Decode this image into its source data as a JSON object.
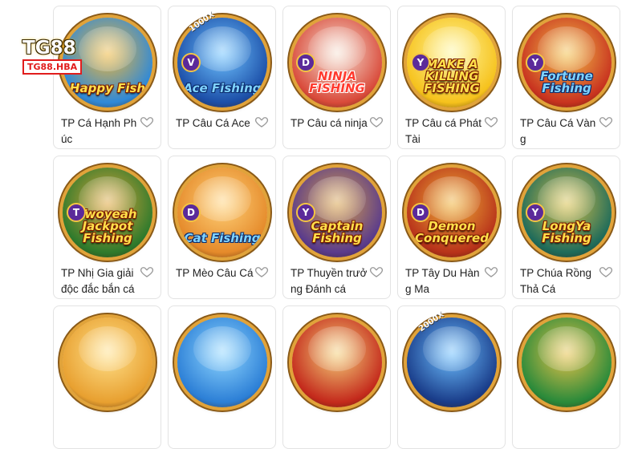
{
  "logo": {
    "brand": "TG88",
    "domain": "TG88.HBA"
  },
  "games": [
    {
      "name": "TP Cá Hạnh Phúc",
      "art_title": "Happy Fish",
      "badge": "",
      "ribbon": "",
      "colors": [
        "#2f89d8",
        "#f0b73a"
      ]
    },
    {
      "name": "TP Câu Cá Ace",
      "art_title": "Ace Fishing",
      "badge": "V",
      "ribbon": "1000X",
      "colors": [
        "#1c4fa8",
        "#6fc3ff"
      ]
    },
    {
      "name": "TP Câu cá ninja",
      "art_title": "NINJA FISHING",
      "badge": "D",
      "ribbon": "",
      "colors": [
        "#d94a3a",
        "#f6e4d6"
      ]
    },
    {
      "name": "TP Câu cá Phát Tài",
      "art_title": "MAKE A KILLING FISHING",
      "badge": "Y",
      "ribbon": "",
      "colors": [
        "#f6c21c",
        "#fff7a0"
      ]
    },
    {
      "name": "TP Câu Cá Vàng",
      "art_title": "Fortune Fishing",
      "badge": "Y",
      "ribbon": "",
      "colors": [
        "#c8321f",
        "#f3c14a"
      ]
    },
    {
      "name": "TP Nhị Gia giải độc đắc bắn cá",
      "art_title": "Twoyeah Jackpot Fishing",
      "badge": "T",
      "ribbon": "",
      "colors": [
        "#2e7a2c",
        "#e0a53a"
      ]
    },
    {
      "name": "TP Mèo Câu Cá",
      "art_title": "Cat Fishing",
      "badge": "D",
      "ribbon": "",
      "colors": [
        "#e58a2a",
        "#ffd27a"
      ]
    },
    {
      "name": "TP Thuyền trưởng Đánh cá",
      "art_title": "Captain Fishing",
      "badge": "Y",
      "ribbon": "",
      "colors": [
        "#5a3b8c",
        "#d9a24a"
      ]
    },
    {
      "name": "TP Tây Du Hàng Ma",
      "art_title": "Demon Conquered",
      "badge": "D",
      "ribbon": "",
      "colors": [
        "#b8321a",
        "#f0b238"
      ]
    },
    {
      "name": "TP Chúa Rồng Thả Cá",
      "art_title": "LongYa Fishing",
      "badge": "Y",
      "ribbon": "",
      "colors": [
        "#1e6b5a",
        "#d9c04a"
      ]
    },
    {
      "name": "",
      "art_title": "",
      "badge": "",
      "ribbon": "",
      "colors": [
        "#e8a030",
        "#ffe08a"
      ]
    },
    {
      "name": "",
      "art_title": "",
      "badge": "",
      "ribbon": "",
      "colors": [
        "#2c7fd6",
        "#8fd6ff"
      ]
    },
    {
      "name": "",
      "art_title": "",
      "badge": "",
      "ribbon": "",
      "colors": [
        "#c42a1c",
        "#f4d07a"
      ]
    },
    {
      "name": "",
      "art_title": "",
      "badge": "",
      "ribbon": "2000X",
      "colors": [
        "#1a3d8a",
        "#6ec0ff"
      ]
    },
    {
      "name": "",
      "art_title": "",
      "badge": "",
      "ribbon": "",
      "colors": [
        "#2a8a3a",
        "#e8c24a"
      ]
    }
  ],
  "accent_heart_color": "#9a9a9a"
}
